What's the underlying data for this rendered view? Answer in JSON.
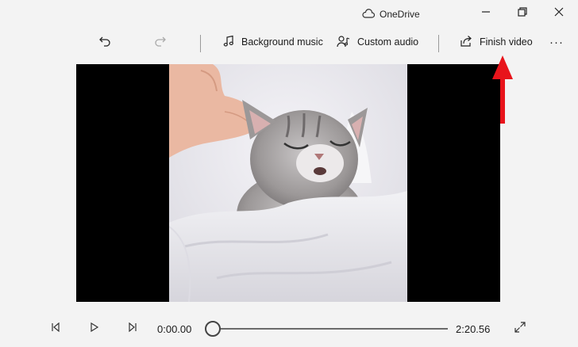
{
  "titlebar": {
    "title": "OneDrive",
    "icons": {
      "cloud": "cloud-icon",
      "minimize": "minimize-icon",
      "restore": "restore-icon",
      "close": "close-icon"
    }
  },
  "toolbar": {
    "undo_icon": "undo-icon",
    "redo_icon": "redo-icon",
    "background_music_label": "Background music",
    "custom_audio_label": "Custom audio",
    "finish_video_label": "Finish video",
    "more_label": "···"
  },
  "video": {
    "subject": "kitten-video-frame"
  },
  "annotation": {
    "arrow_color": "#e8141b"
  },
  "playback": {
    "current_time": "0:00.00",
    "total_time": "2:20.56",
    "progress": 0.0
  },
  "colors": {
    "background": "#f3f3f3",
    "stage": "#000000",
    "accent_arrow": "#e8141b"
  }
}
